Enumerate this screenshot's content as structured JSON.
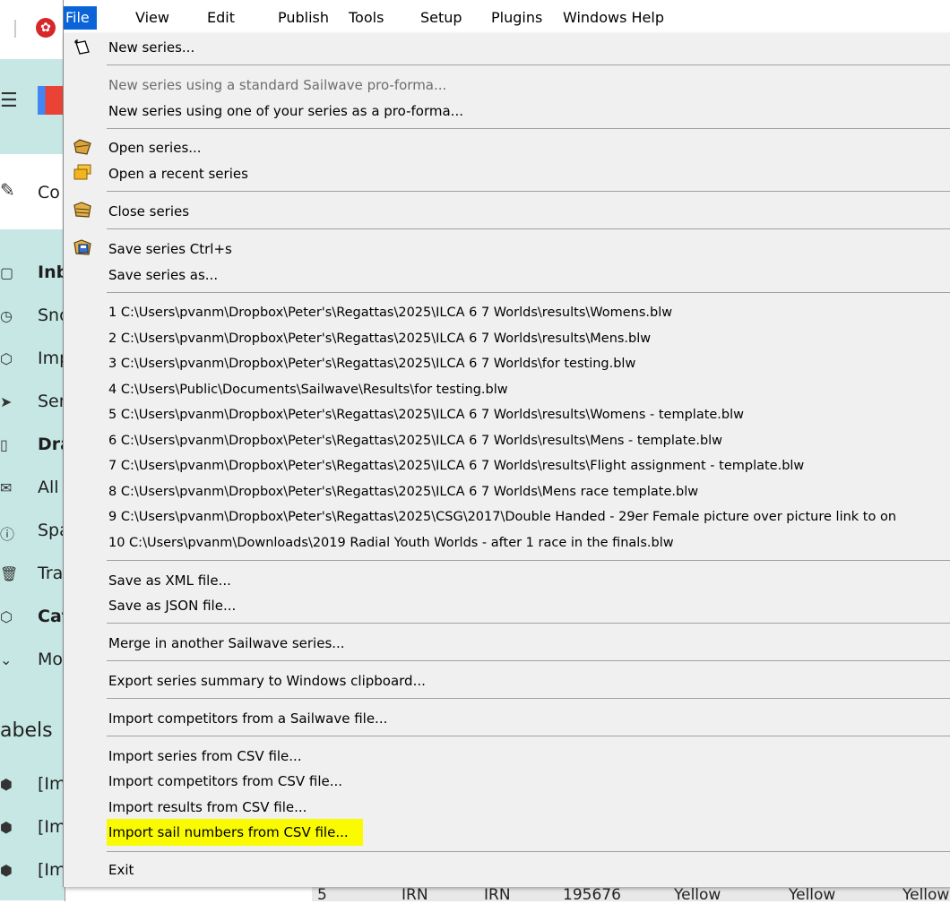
{
  "background": {
    "sidebar": [
      {
        "icon": "inbox-icon",
        "label": "Inb",
        "bold": true
      },
      {
        "icon": "clock-icon",
        "label": "Sno",
        "bold": false
      },
      {
        "icon": "label-icon",
        "label": "Imp",
        "bold": false
      },
      {
        "icon": "send-icon",
        "label": "Sen",
        "bold": false
      },
      {
        "icon": "file-icon",
        "label": "Dra",
        "bold": true
      },
      {
        "icon": "mail-icon",
        "label": "All",
        "bold": false
      },
      {
        "icon": "alert-icon",
        "label": "Spa",
        "bold": false
      },
      {
        "icon": "trash-icon",
        "label": "Tra",
        "bold": false
      },
      {
        "icon": "label-icon",
        "label": "Cat",
        "bold": true
      },
      {
        "icon": "chevron-icon",
        "label": "Mo",
        "bold": false
      }
    ],
    "compose_label": "Co",
    "labels_heading": "abels",
    "label_items": [
      "[Im",
      "[Im",
      "[Im"
    ],
    "table_row": [
      "5",
      "IRN",
      "IRN",
      "195676",
      "Yellow",
      "Yellow",
      "Yellow"
    ]
  },
  "menubar": {
    "items": [
      "File",
      "View",
      "Edit",
      "Publish",
      "Tools",
      "Setup",
      "Plugins",
      "Windows Help"
    ],
    "active": "File"
  },
  "file_menu": {
    "new_series": "New series...",
    "new_from_proforma": "New series using a standard Sailwave pro-forma...",
    "new_from_series": "New series using one of your series as a pro-forma...",
    "open_series": "Open series...",
    "open_recent": "Open a recent series",
    "close_series": "Close series",
    "save_series": "Save series    Ctrl+s",
    "save_series_as": "Save series as...",
    "recent_files": [
      "1 C:\\Users\\pvanm\\Dropbox\\Peter's\\Regattas\\2025\\ILCA 6  7 Worlds\\results\\Womens.blw",
      "2 C:\\Users\\pvanm\\Dropbox\\Peter's\\Regattas\\2025\\ILCA 6  7 Worlds\\results\\Mens.blw",
      "3 C:\\Users\\pvanm\\Dropbox\\Peter's\\Regattas\\2025\\ILCA 6  7 Worlds\\for testing.blw",
      "4 C:\\Users\\Public\\Documents\\Sailwave\\Results\\for testing.blw",
      "5 C:\\Users\\pvanm\\Dropbox\\Peter's\\Regattas\\2025\\ILCA 6  7 Worlds\\results\\Womens - template.blw",
      "6 C:\\Users\\pvanm\\Dropbox\\Peter's\\Regattas\\2025\\ILCA 6  7 Worlds\\results\\Mens - template.blw",
      "7 C:\\Users\\pvanm\\Dropbox\\Peter's\\Regattas\\2025\\ILCA 6  7 Worlds\\results\\Flight assignment - template.blw",
      "8 C:\\Users\\pvanm\\Dropbox\\Peter's\\Regattas\\2025\\ILCA 6  7 Worlds\\Mens race template.blw",
      "9 C:\\Users\\pvanm\\Dropbox\\Peter's\\Regattas\\2025\\CSG\\2017\\Double Handed - 29er Female  picture over picture  link to on",
      "10 C:\\Users\\pvanm\\Downloads\\2019 Radial Youth Worlds - after 1 race in the finals.blw"
    ],
    "save_xml": "Save as XML file...",
    "save_json": "Save as JSON file...",
    "merge": "Merge in another Sailwave series...",
    "export_summary": "Export series summary to Windows clipboard...",
    "import_competitors_sailwave": "Import competitors from a Sailwave file...",
    "import_series_csv": "Import series from CSV file...",
    "import_competitors_csv": "Import competitors from CSV file...",
    "import_results_csv": "Import results from CSV file...",
    "import_sailnumbers_csv": "Import sail numbers from CSV file...",
    "exit": "Exit"
  },
  "colors": {
    "menu_active": "#0a64d8",
    "highlight": "#fafa00",
    "menu_bg": "#f0f0f0"
  }
}
